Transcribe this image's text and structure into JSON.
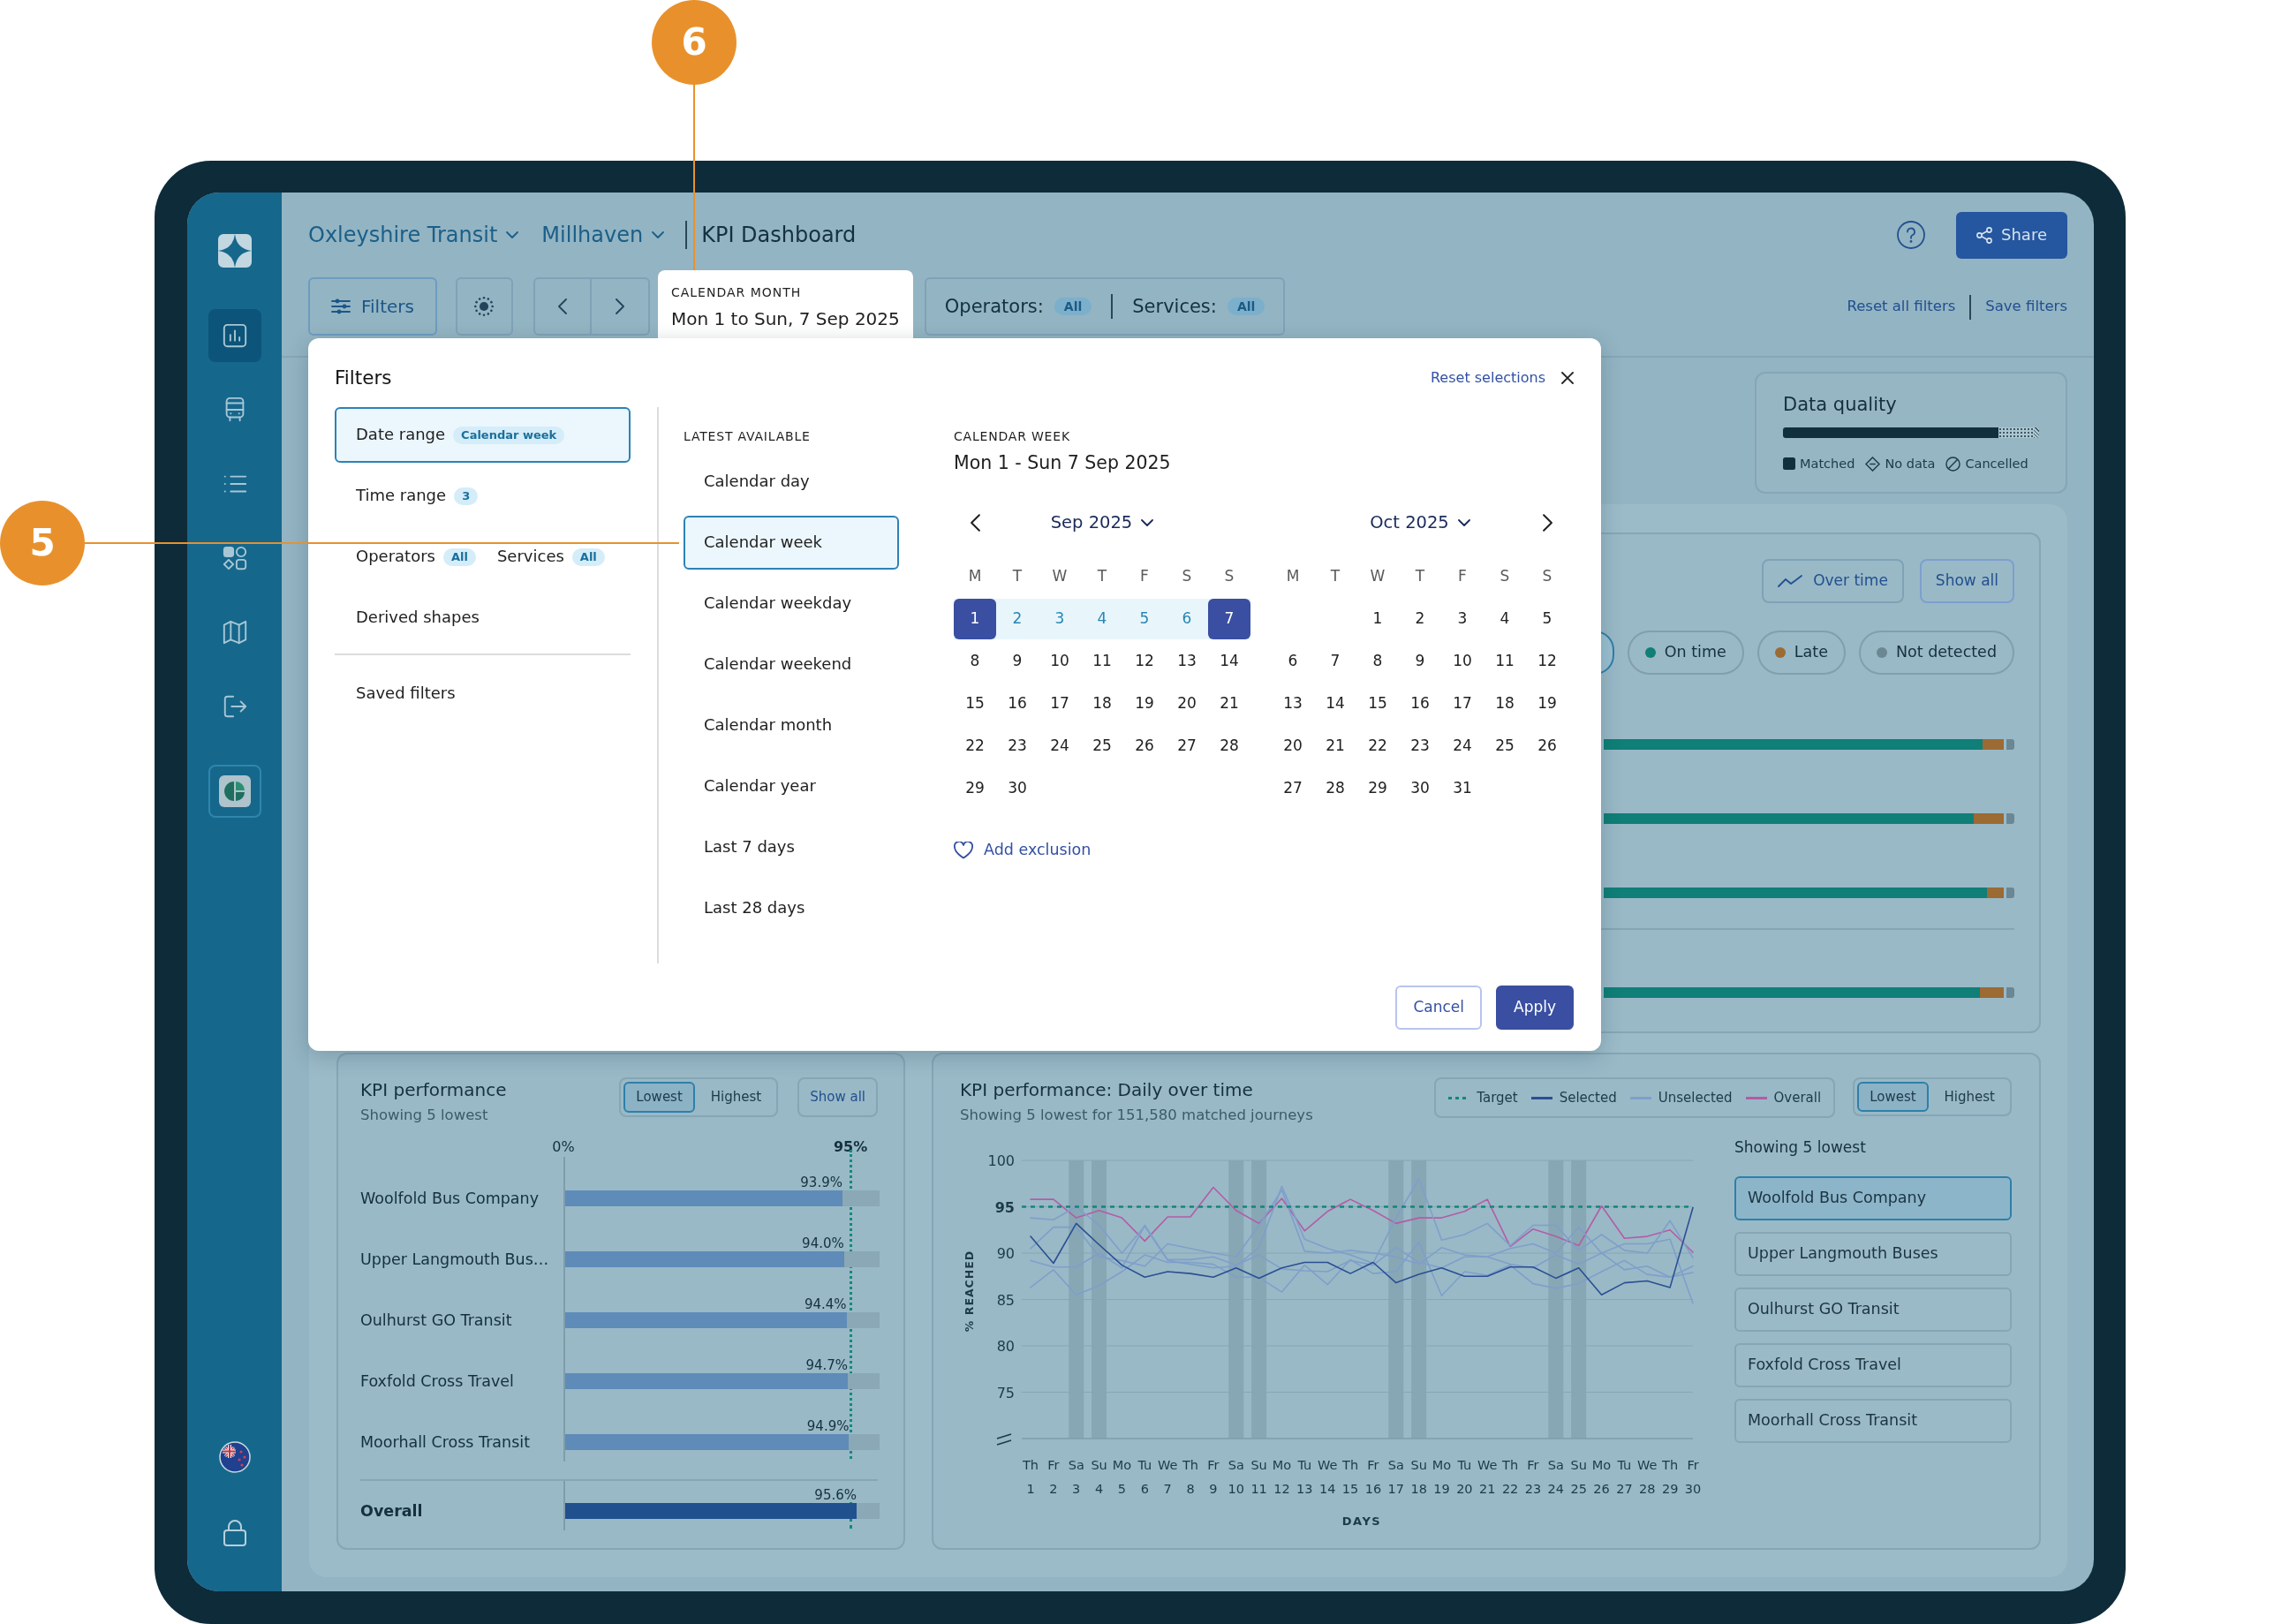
{
  "callouts": [
    {
      "label": "5",
      "kind": "right"
    },
    {
      "label": "6",
      "kind": "down"
    }
  ],
  "sidebar": {
    "items": [
      {
        "kind": "page",
        "selected": true
      },
      {
        "kind": "page",
        "selected": false
      },
      {
        "kind": "page",
        "selected": false
      },
      {
        "kind": "page",
        "selected": false
      },
      {
        "kind": "page",
        "selected": false
      },
      {
        "kind": "page",
        "selected": false
      },
      {
        "kind": "app",
        "selected": false
      }
    ]
  },
  "header": {
    "breadcrumbs": [
      {
        "label": "Oxleyshire Transit",
        "dropdown": true
      },
      {
        "label": "Millhaven",
        "dropdown": true
      },
      {
        "label": "KPI Dashboard",
        "dropdown": false
      }
    ],
    "share": "Share"
  },
  "filter_bar": {
    "filters_button": "Filters",
    "date_tab": {
      "caption": "CALENDAR MONTH",
      "value": "Mon 1 to Sun, 7 Sep 2025",
      "selected": true
    },
    "scopes": [
      {
        "label": "Operators:",
        "badge": "All"
      },
      {
        "label": "Services:",
        "badge": "All"
      }
    ],
    "links": [
      "Reset all filters",
      "Save filters"
    ]
  },
  "filters_dialog": {
    "title": "Filters",
    "reset": "Reset selections",
    "groups": [
      {
        "selected": true,
        "entries": [
          {
            "label": "Date range",
            "badge": "Calendar week"
          }
        ]
      },
      {
        "selected": false,
        "entries": [
          {
            "label": "Time range",
            "badge": "3"
          }
        ]
      },
      {
        "selected": false,
        "entries": [
          {
            "label": "Operators",
            "badge": "All"
          },
          {
            "label": "Services",
            "badge": "All"
          }
        ]
      },
      {
        "selected": false,
        "entries": [
          {
            "label": "Derived shapes"
          }
        ]
      }
    ],
    "saved": "Saved filters",
    "options_heading": "LATEST AVAILABLE",
    "options": [
      {
        "label": "Calendar day",
        "selected": false
      },
      {
        "label": "Calendar week",
        "selected": true
      },
      {
        "label": "Calendar weekday",
        "selected": false
      },
      {
        "label": "Calendar weekend",
        "selected": false
      },
      {
        "label": "Calendar month",
        "selected": false
      },
      {
        "label": "Calendar year",
        "selected": false
      },
      {
        "label": "Last 7 days",
        "selected": false
      },
      {
        "label": "Last 28 days",
        "selected": false
      }
    ],
    "range_caption": "CALENDAR WEEK",
    "range_value": "Mon 1 - Sun 7 Sep 2025",
    "months": [
      {
        "title": "Sep 2025",
        "weekdays": [
          "M",
          "T",
          "W",
          "T",
          "F",
          "S",
          "S"
        ],
        "weeks": [
          [
            {
              "label": "1",
              "selected": true,
              "in_range": true
            },
            {
              "label": "2",
              "selected": false,
              "in_range": true
            },
            {
              "label": "3",
              "selected": false,
              "in_range": true
            },
            {
              "label": "4",
              "selected": false,
              "in_range": true
            },
            {
              "label": "5",
              "selected": false,
              "in_range": true
            },
            {
              "label": "6",
              "selected": false,
              "in_range": true
            },
            {
              "label": "7",
              "selected": true,
              "in_range": true
            }
          ],
          [
            {
              "label": "8",
              "selected": false,
              "in_range": false
            },
            {
              "label": "9",
              "selected": false,
              "in_range": false
            },
            {
              "label": "10",
              "selected": false,
              "in_range": false
            },
            {
              "label": "11",
              "selected": false,
              "in_range": false
            },
            {
              "label": "12",
              "selected": false,
              "in_range": false
            },
            {
              "label": "13",
              "selected": false,
              "in_range": false
            },
            {
              "label": "14",
              "selected": false,
              "in_range": false
            }
          ],
          [
            {
              "label": "15",
              "selected": false,
              "in_range": false
            },
            {
              "label": "16",
              "selected": false,
              "in_range": false
            },
            {
              "label": "17",
              "selected": false,
              "in_range": false
            },
            {
              "label": "18",
              "selected": false,
              "in_range": false
            },
            {
              "label": "19",
              "selected": false,
              "in_range": false
            },
            {
              "label": "20",
              "selected": false,
              "in_range": false
            },
            {
              "label": "21",
              "selected": false,
              "in_range": false
            }
          ],
          [
            {
              "label": "22",
              "selected": false,
              "in_range": false
            },
            {
              "label": "23",
              "selected": false,
              "in_range": false
            },
            {
              "label": "24",
              "selected": false,
              "in_range": false
            },
            {
              "label": "25",
              "selected": false,
              "in_range": false
            },
            {
              "label": "26",
              "selected": false,
              "in_range": false
            },
            {
              "label": "27",
              "selected": false,
              "in_range": false
            },
            {
              "label": "28",
              "selected": false,
              "in_range": false
            }
          ],
          [
            {
              "label": "29",
              "selected": false,
              "in_range": false
            },
            {
              "label": "30",
              "selected": false,
              "in_range": false
            }
          ]
        ]
      },
      {
        "title": "Oct 2025",
        "weekdays": [
          "M",
          "T",
          "W",
          "T",
          "F",
          "S",
          "S"
        ],
        "weeks": [
          [
            {
              "label": "1",
              "selected": false,
              "in_range": false
            },
            {
              "label": "2",
              "selected": false,
              "in_range": false
            },
            {
              "label": "3",
              "selected": false,
              "in_range": false
            },
            {
              "label": "4",
              "selected": false,
              "in_range": false
            },
            {
              "label": "5",
              "selected": false,
              "in_range": false
            }
          ],
          [
            {
              "label": "6",
              "selected": false,
              "in_range": false
            },
            {
              "label": "7",
              "selected": false,
              "in_range": false
            },
            {
              "label": "8",
              "selected": false,
              "in_range": false
            },
            {
              "label": "9",
              "selected": false,
              "in_range": false
            },
            {
              "label": "10",
              "selected": false,
              "in_range": false
            },
            {
              "label": "11",
              "selected": false,
              "in_range": false
            },
            {
              "label": "12",
              "selected": false,
              "in_range": false
            }
          ],
          [
            {
              "label": "13",
              "selected": false,
              "in_range": false
            },
            {
              "label": "14",
              "selected": false,
              "in_range": false
            },
            {
              "label": "15",
              "selected": false,
              "in_range": false
            },
            {
              "label": "16",
              "selected": false,
              "in_range": false
            },
            {
              "label": "17",
              "selected": false,
              "in_range": false
            },
            {
              "label": "18",
              "selected": false,
              "in_range": false
            },
            {
              "label": "19",
              "selected": false,
              "in_range": false
            }
          ],
          [
            {
              "label": "20",
              "selected": false,
              "in_range": false
            },
            {
              "label": "21",
              "selected": false,
              "in_range": false
            },
            {
              "label": "22",
              "selected": false,
              "in_range": false
            },
            {
              "label": "23",
              "selected": false,
              "in_range": false
            },
            {
              "label": "24",
              "selected": false,
              "in_range": false
            },
            {
              "label": "25",
              "selected": false,
              "in_range": false
            },
            {
              "label": "26",
              "selected": false,
              "in_range": false
            }
          ],
          [
            {
              "label": "27",
              "selected": false,
              "in_range": false
            },
            {
              "label": "28",
              "selected": false,
              "in_range": false
            },
            {
              "label": "29",
              "selected": false,
              "in_range": false
            },
            {
              "label": "30",
              "selected": false,
              "in_range": false
            },
            {
              "label": "31",
              "selected": false,
              "in_range": false
            }
          ]
        ]
      }
    ],
    "add_exclusion": "Add exclusion",
    "buttons": [
      {
        "label": "Cancel",
        "kind": "secondary"
      },
      {
        "label": "Apply",
        "kind": "primary"
      }
    ]
  },
  "data_quality": {
    "title": "Data quality",
    "level": 0.84,
    "legend": [
      {
        "label": "Matched",
        "kind": "matched"
      },
      {
        "label": "No data",
        "kind": "no_data"
      },
      {
        "label": "Cancelled",
        "kind": "cancelled"
      }
    ]
  },
  "breakdown": {
    "buttons": [
      {
        "label": "Over time",
        "icon": true
      },
      {
        "label": "Show all",
        "icon": false
      }
    ],
    "chips": [
      {
        "selected": true
      },
      {
        "label": "On time",
        "color": "#0f7f77",
        "selected": false
      },
      {
        "label": "Late",
        "color": "#9c6a33",
        "selected": false
      },
      {
        "label": "Not detected",
        "color": "#6b8794",
        "selected": false
      }
    ],
    "rows": [
      {
        "level": 0.923,
        "divider_before": false
      },
      {
        "level": 0.901,
        "divider_before": false
      },
      {
        "level": 0.933,
        "divider_before": false
      },
      {
        "level": 0.916,
        "divider_before": true
      }
    ]
  },
  "kpi_performance": {
    "title": "KPI performance",
    "subtitle": "Showing 5 lowest",
    "toggle": [
      {
        "label": "Lowest",
        "selected": true
      },
      {
        "label": "Highest",
        "selected": false
      }
    ],
    "show_all": "Show all",
    "axis_start": "0%",
    "axis_target": "95%",
    "rows": [
      {
        "label": "Woolfold Bus Company",
        "reading": "93.9%",
        "level": 0.882
      },
      {
        "label": "Upper Langmouth Bus…",
        "reading": "94.0%",
        "level": 0.887
      },
      {
        "label": "Oulhurst GO Transit",
        "reading": "94.4%",
        "level": 0.895
      },
      {
        "label": "Foxfold Cross Travel",
        "reading": "94.7%",
        "level": 0.899
      },
      {
        "label": "Moorhall Cross Transit",
        "reading": "94.9%",
        "level": 0.903
      }
    ],
    "overall": {
      "label": "Overall",
      "reading": "95.6%",
      "level": 0.927
    }
  },
  "daily": {
    "title": "KPI performance: Daily over time",
    "subtitle": "Showing 5 lowest for 151,580 matched journeys",
    "legend": [
      {
        "label": "Selected",
        "color": "#2b4f92"
      },
      {
        "label": "Unselected",
        "color": "#7f9fca"
      }
    ],
    "toggle": [
      {
        "label": "Lowest",
        "selected": true
      },
      {
        "label": "Highest",
        "selected": false
      }
    ],
    "days": [
      {
        "weekday": "Th",
        "weekend": false
      },
      {
        "weekday": "Fr",
        "weekend": false
      },
      {
        "weekday": "Sa",
        "weekend": true
      },
      {
        "weekday": "Su",
        "weekend": true
      },
      {
        "weekday": "Mo",
        "weekend": false
      },
      {
        "weekday": "Tu",
        "weekend": false
      },
      {
        "weekday": "We",
        "weekend": false
      },
      {
        "weekday": "Th",
        "weekend": false
      },
      {
        "weekday": "Fr",
        "weekend": false
      },
      {
        "weekday": "Sa",
        "weekend": true
      },
      {
        "weekday": "Su",
        "weekend": true
      },
      {
        "weekday": "Mo",
        "weekend": false
      },
      {
        "weekday": "Tu",
        "weekend": false
      },
      {
        "weekday": "We",
        "weekend": false
      },
      {
        "weekday": "Th",
        "weekend": false
      },
      {
        "weekday": "Fr",
        "weekend": false
      },
      {
        "weekday": "Sa",
        "weekend": true
      },
      {
        "weekday": "Su",
        "weekend": true
      },
      {
        "weekday": "Mo",
        "weekend": false
      },
      {
        "weekday": "Tu",
        "weekend": false
      },
      {
        "weekday": "We",
        "weekend": false
      },
      {
        "weekday": "Th",
        "weekend": false
      },
      {
        "weekday": "Fr",
        "weekend": false
      },
      {
        "weekday": "Sa",
        "weekend": true
      },
      {
        "weekday": "Su",
        "weekend": true
      },
      {
        "weekday": "Mo",
        "weekend": false
      },
      {
        "weekday": "Tu",
        "weekend": false
      },
      {
        "weekday": "We",
        "weekend": false
      },
      {
        "weekday": "Th",
        "weekend": false
      },
      {
        "weekday": "Fr",
        "weekend": false
      }
    ],
    "chart_data": {
      "type": "line",
      "xlabel": "DAYS",
      "ylabel": "% REACHED",
      "categories": [
        "1",
        "2",
        "3",
        "4",
        "5",
        "6",
        "7",
        "8",
        "9",
        "10",
        "11",
        "12",
        "13",
        "14",
        "15",
        "16",
        "17",
        "18",
        "19",
        "20",
        "21",
        "22",
        "23",
        "24",
        "25",
        "26",
        "27",
        "28",
        "29",
        "30"
      ],
      "ylim": [
        70,
        100
      ],
      "yticks": [
        75,
        80,
        85,
        90,
        95,
        100
      ],
      "grid": true,
      "series": [
        {
          "name": "Woolfold Bus Company",
          "color": "#2b4f92",
          "values": [
            91.8,
            88.9,
            93.2,
            90.9,
            88.7,
            87.4,
            88.0,
            87.8,
            87.4,
            88.4,
            87.3,
            88.4,
            89.0,
            89.0,
            87.8,
            89.0,
            86.8,
            87.7,
            88.4,
            87.5,
            87.5,
            88.5,
            88.5,
            87.3,
            88.4,
            85.5,
            86.8,
            87.0,
            86.3,
            94.9
          ]
        },
        {
          "name": "Upper Langmouth Buses",
          "color": "#7f9fca",
          "values": [
            93.8,
            93.6,
            95.0,
            93.0,
            90.0,
            92.9,
            89.2,
            88.8,
            88.4,
            88.6,
            90.6,
            97.2,
            91.5,
            90.5,
            89.8,
            88.9,
            93.8,
            98.0,
            91.4,
            92.0,
            93.2,
            90.8,
            93.0,
            93.0,
            90.3,
            92.0,
            90.3,
            90.0,
            93.5,
            89.5
          ]
        },
        {
          "name": "Oulhurst GO Transit",
          "color": "#7f9fca",
          "values": [
            89.2,
            88.5,
            88.5,
            90.0,
            88.4,
            93.0,
            89.3,
            89.3,
            89.6,
            88.7,
            89.8,
            88.3,
            88.1,
            88.0,
            89.2,
            88.7,
            90.6,
            89.0,
            88.4,
            89.6,
            89.6,
            88.8,
            88.4,
            89.8,
            88.8,
            90.0,
            88.2,
            88.6,
            87.4,
            88.6
          ]
        },
        {
          "name": "Foxfold Cross Travel",
          "color": "#7f9fca",
          "values": [
            86.3,
            88.2,
            85.5,
            86.5,
            88.0,
            89.8,
            89.0,
            89.0,
            88.8,
            87.4,
            87.4,
            85.8,
            88.7,
            86.6,
            89.3,
            87.8,
            88.0,
            91.2,
            85.4,
            88.0,
            87.6,
            88.7,
            86.7,
            86.2,
            86.7,
            88.0,
            89.2,
            87.7,
            87.4,
            87.9
          ]
        },
        {
          "name": "Moorhall Cross Transit",
          "color": "#7f9fca",
          "values": [
            90.5,
            92.8,
            92.8,
            89.6,
            89.2,
            88.6,
            91.0,
            90.5,
            90.0,
            89.6,
            93.0,
            96.8,
            90.2,
            90.0,
            90.3,
            90.0,
            89.6,
            88.8,
            90.6,
            89.8,
            89.6,
            90.5,
            91.0,
            90.0,
            92.8,
            90.0,
            91.0,
            91.0,
            91.5,
            84.6
          ]
        },
        {
          "name": "Overall",
          "color": "#b45ca5",
          "values": [
            95.8,
            95.8,
            93.8,
            94.6,
            93.8,
            91.3,
            93.9,
            93.9,
            97.1,
            94.6,
            93.2,
            95.9,
            92.4,
            94.5,
            95.8,
            94.6,
            93.2,
            93.8,
            93.8,
            94.5,
            95.8,
            90.7,
            92.6,
            91.8,
            90.8,
            95.1,
            91.6,
            91.8,
            92.5,
            90.1
          ]
        }
      ],
      "ref_lines": [
        {
          "axis": "y",
          "value": 95,
          "label": "Target",
          "color": "#12877a"
        }
      ]
    },
    "list_title": "Showing 5 lowest",
    "operators": [
      {
        "selected": true
      },
      {
        "selected": false
      },
      {
        "selected": false
      },
      {
        "selected": false
      },
      {
        "selected": false
      }
    ]
  }
}
